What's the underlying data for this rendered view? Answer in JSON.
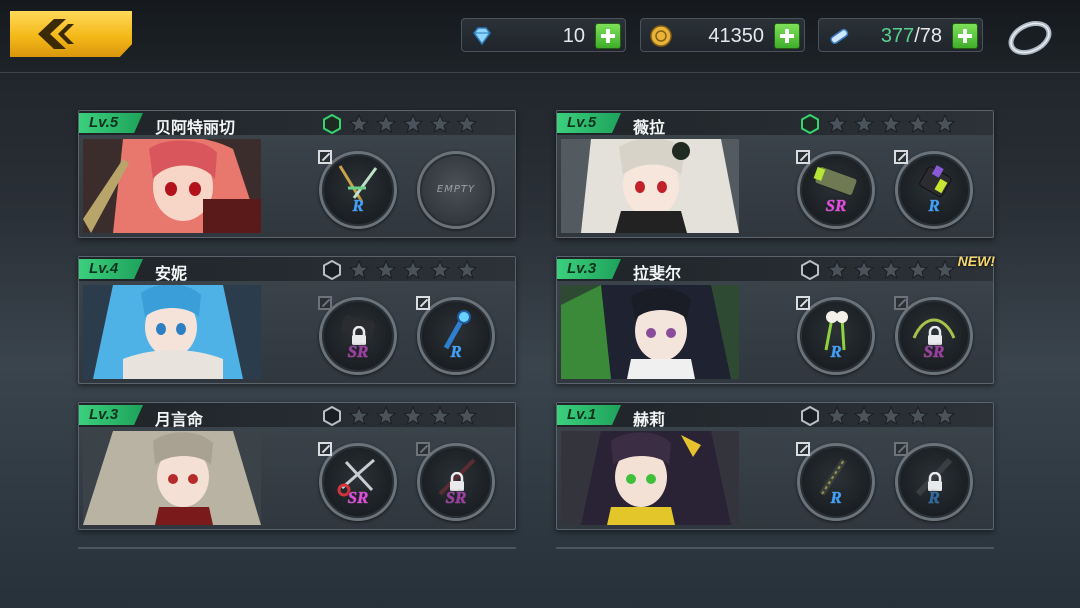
{
  "topbar": {
    "back_icon": "chevron-left-icon",
    "gems": {
      "icon": "gem-icon",
      "value": "10"
    },
    "gold": {
      "icon": "coin-icon",
      "value": "41350"
    },
    "energy": {
      "icon": "energy-bandage-icon",
      "current": "377",
      "max": "/78"
    },
    "ring_icon": "ring-icon"
  },
  "colors": {
    "level_badge": "#2bbd6e",
    "sr": "#e24ce0",
    "r": "#3ea1ff",
    "plus": "#4cc23a",
    "back_button": "#f4b918"
  },
  "characters": [
    {
      "level": "Lv.5",
      "name": "贝阿特丽切",
      "stars": 0,
      "frame": "green",
      "badge": "",
      "slots": [
        {
          "rarity": "R",
          "locked": false,
          "empty": false
        },
        {
          "rarity": "",
          "locked": false,
          "empty": true,
          "empty_text": "EMPTY"
        }
      ]
    },
    {
      "level": "Lv.5",
      "name": "薇拉",
      "stars": 0,
      "frame": "green",
      "badge": "",
      "slots": [
        {
          "rarity": "SR",
          "locked": false,
          "empty": false
        },
        {
          "rarity": "R",
          "locked": false,
          "empty": false
        }
      ]
    },
    {
      "level": "Lv.4",
      "name": "安妮",
      "stars": 0,
      "frame": "grey",
      "badge": "",
      "slots": [
        {
          "rarity": "SR",
          "locked": true,
          "empty": false
        },
        {
          "rarity": "R",
          "locked": false,
          "empty": false
        }
      ]
    },
    {
      "level": "Lv.3",
      "name": "拉斐尔",
      "stars": 0,
      "frame": "grey",
      "badge": "NEW!",
      "slots": [
        {
          "rarity": "R",
          "locked": false,
          "empty": false
        },
        {
          "rarity": "SR",
          "locked": true,
          "empty": false
        }
      ]
    },
    {
      "level": "Lv.3",
      "name": "月言命",
      "stars": 0,
      "frame": "grey",
      "badge": "",
      "slots": [
        {
          "rarity": "SR",
          "locked": false,
          "empty": false
        },
        {
          "rarity": "SR",
          "locked": true,
          "empty": false
        }
      ]
    },
    {
      "level": "Lv.1",
      "name": "赫莉",
      "stars": 0,
      "frame": "grey",
      "badge": "",
      "slots": [
        {
          "rarity": "R",
          "locked": false,
          "empty": false
        },
        {
          "rarity": "R",
          "locked": true,
          "empty": false
        }
      ]
    }
  ]
}
